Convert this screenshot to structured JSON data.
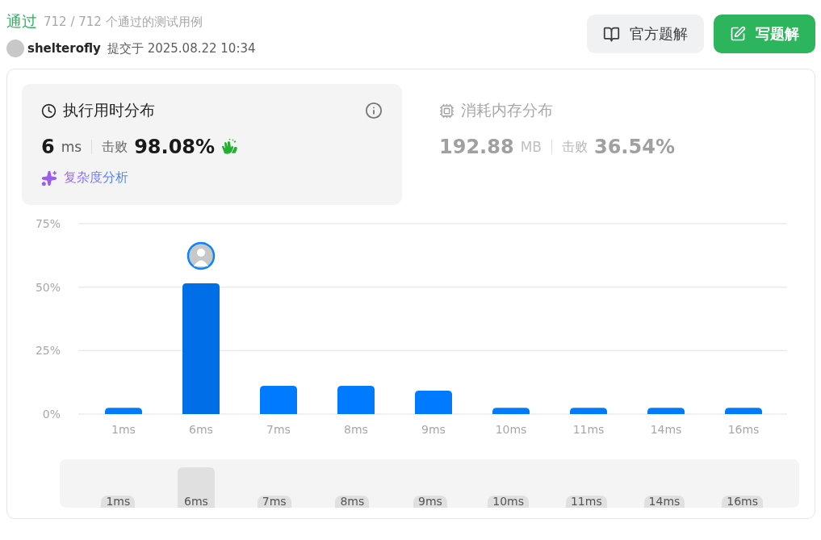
{
  "result": {
    "status": "通过",
    "testcases": "712 / 712 个通过的测试用例"
  },
  "submission": {
    "user": "shelterofly",
    "submitted_at": "提交于 2025.08.22 10:34"
  },
  "buttons": [
    {
      "kind": "secondary",
      "label": "官方题解"
    },
    {
      "kind": "primary",
      "label": "写题解"
    }
  ],
  "metrics": [
    {
      "kind": "runtime",
      "selected": true,
      "title": "执行用时分布",
      "value": "6",
      "unit": "ms",
      "beats_label": "击败",
      "beats": "98.08%",
      "link": "复杂度分析"
    },
    {
      "kind": "memory",
      "selected": false,
      "title": "消耗内存分布",
      "value": "192.88",
      "unit": "MB",
      "beats_label": "击败",
      "beats": "36.54%"
    }
  ],
  "chart": {
    "chart_data": {
      "type": "bar",
      "categories": [
        "1ms",
        "6ms",
        "7ms",
        "8ms",
        "9ms",
        "10ms",
        "11ms",
        "14ms",
        "16ms"
      ],
      "values": [
        2.5,
        51.5,
        11.1,
        11.1,
        9.2,
        2.5,
        2.5,
        2.5,
        2.5
      ],
      "ylim": [
        0,
        75
      ],
      "yticks": [
        {
          "value": 0,
          "label": "0%"
        },
        {
          "value": 25,
          "label": "25%"
        },
        {
          "value": 50,
          "label": "50%"
        },
        {
          "value": 75,
          "label": "75%"
        }
      ]
    },
    "overview": [
      {
        "label": "1ms",
        "selected": false
      },
      {
        "label": "6ms",
        "selected": true
      },
      {
        "label": "7ms",
        "selected": false
      },
      {
        "label": "8ms",
        "selected": false
      },
      {
        "label": "9ms",
        "selected": false
      },
      {
        "label": "10ms",
        "selected": false
      },
      {
        "label": "11ms",
        "selected": false
      },
      {
        "label": "14ms",
        "selected": false
      },
      {
        "label": "16ms",
        "selected": false
      }
    ]
  }
}
